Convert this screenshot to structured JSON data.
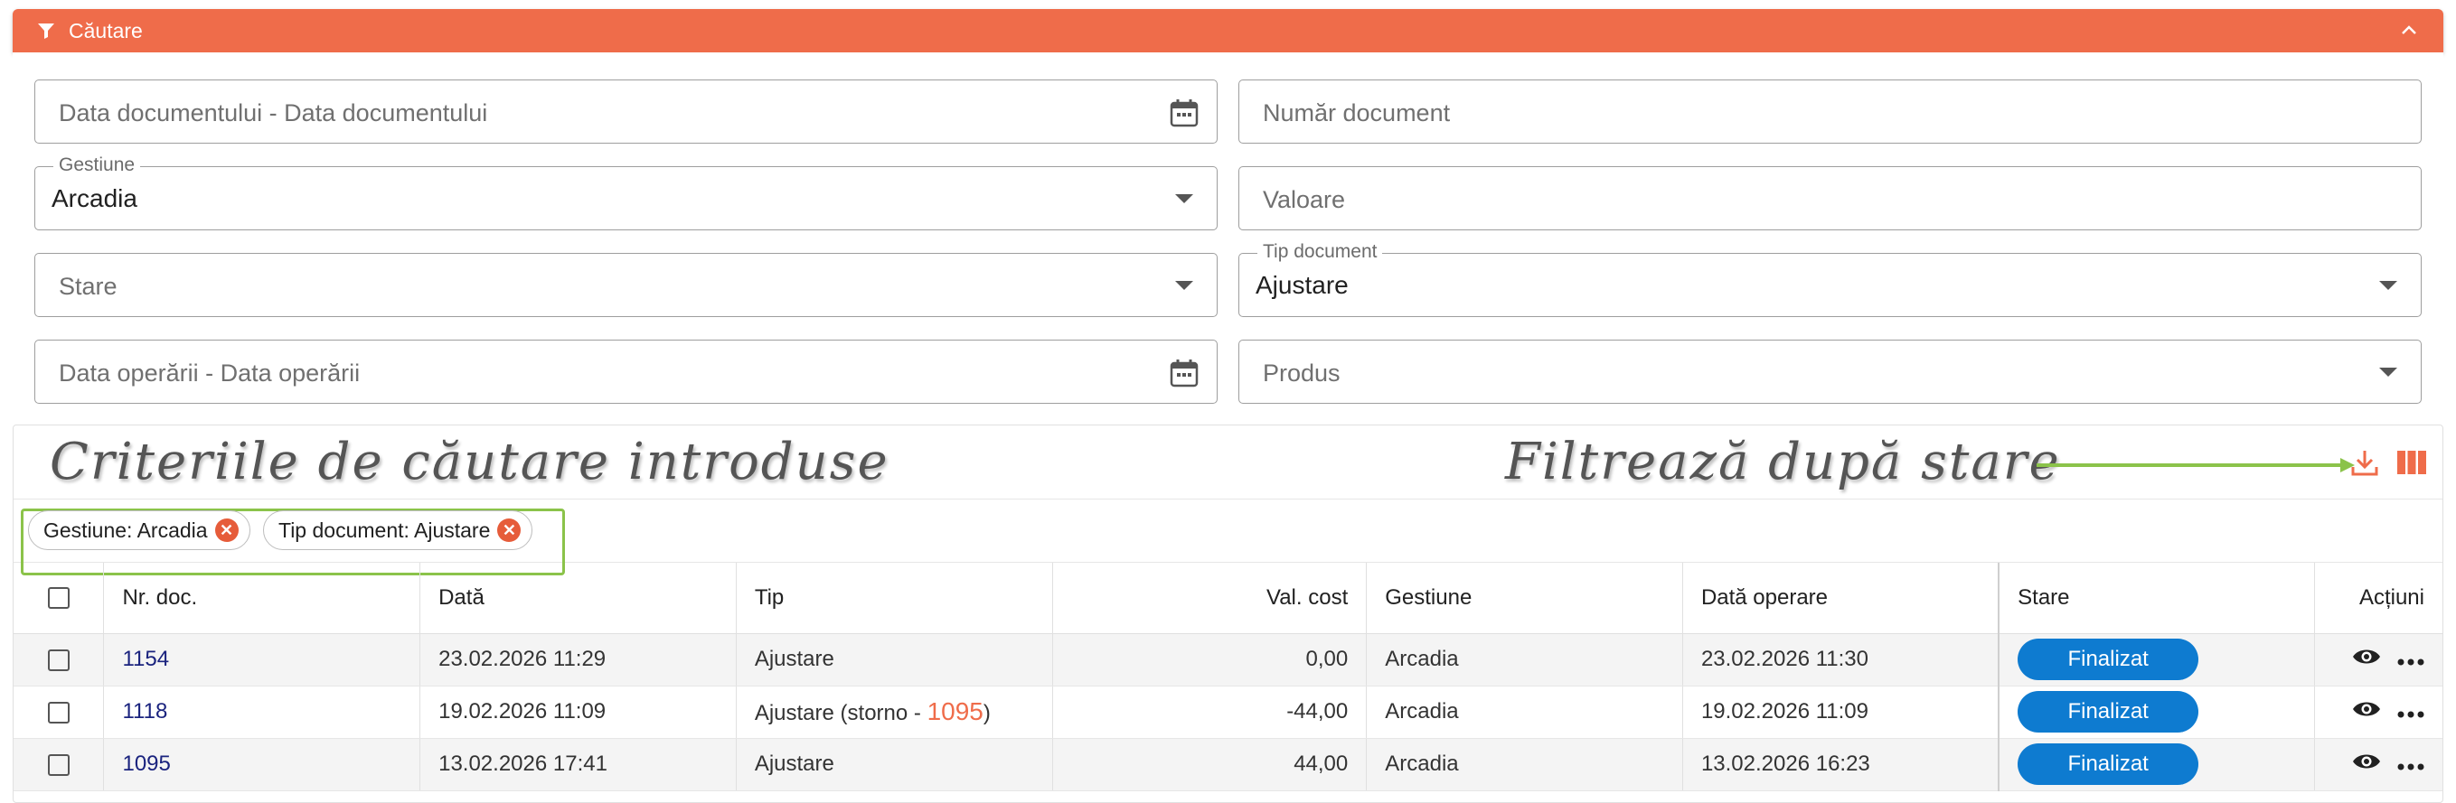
{
  "search_header": {
    "title": "Căutare"
  },
  "form": {
    "doc_date": {
      "placeholder": "Data documentului - Data documentului"
    },
    "doc_number": {
      "placeholder": "Număr document"
    },
    "gestiune": {
      "label": "Gestiune",
      "value": "Arcadia"
    },
    "valoare": {
      "placeholder": "Valoare"
    },
    "stare": {
      "placeholder": "Stare"
    },
    "tip_document": {
      "label": "Tip document",
      "value": "Ajustare"
    },
    "op_date": {
      "placeholder": "Data operării - Data operării"
    },
    "produs": {
      "placeholder": "Produs"
    }
  },
  "annotations": {
    "criteria": "Criteriile de căutare introduse",
    "filter": "Filtrează după stare",
    "highlight_color": "#8bc34a"
  },
  "chips": [
    {
      "label": "Gestiune: Arcadia"
    },
    {
      "label": "Tip document: Ajustare"
    }
  ],
  "table": {
    "headers": {
      "nr_doc": "Nr. doc.",
      "data": "Dată",
      "tip": "Tip",
      "val_cost": "Val. cost",
      "gestiune": "Gestiune",
      "data_operare": "Dată operare",
      "stare": "Stare",
      "actiuni": "Acțiuni"
    },
    "rows": [
      {
        "nr_doc": "1154",
        "data": "23.02.2026 11:29",
        "tip": "Ajustare",
        "tip_suffix_pre": "",
        "tip_ref": "",
        "tip_suffix_post": "",
        "val_cost": "0,00",
        "gestiune": "Arcadia",
        "data_operare": "23.02.2026 11:30",
        "stare": "Finalizat"
      },
      {
        "nr_doc": "1118",
        "data": "19.02.2026 11:09",
        "tip": "Ajustare",
        "tip_suffix_pre": " (storno - ",
        "tip_ref": "1095",
        "tip_suffix_post": ")",
        "val_cost": "-44,00",
        "gestiune": "Arcadia",
        "data_operare": "19.02.2026 11:09",
        "stare": "Finalizat"
      },
      {
        "nr_doc": "1095",
        "data": "13.02.2026 17:41",
        "tip": "Ajustare",
        "tip_suffix_pre": "",
        "tip_ref": "",
        "tip_suffix_post": "",
        "val_cost": "44,00",
        "gestiune": "Arcadia",
        "data_operare": "13.02.2026 16:23",
        "stare": "Finalizat"
      }
    ]
  },
  "colors": {
    "accent": "#ef6c4a",
    "status_button": "#0e7bd0",
    "link": "#1a237e"
  }
}
